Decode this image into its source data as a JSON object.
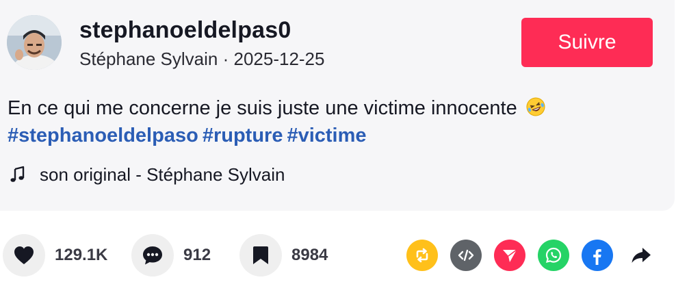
{
  "post": {
    "username": "stephanoeldelpas0",
    "display_name": "Stéphane Sylvain",
    "separator": " · ",
    "date": "2025-12-25",
    "follow_label": "Suivre",
    "description": "En ce qui me concerne je suis juste une victime innocente",
    "hashtags": [
      "#stephanoeldelpaso",
      "#rupture",
      "#victime"
    ],
    "music": "son original - Stéphane Sylvain"
  },
  "actions": {
    "likes": "129.1K",
    "comments": "912",
    "saves": "8984"
  },
  "share_buttons": [
    "repost-icon",
    "embed-icon",
    "send-icon",
    "whatsapp-icon",
    "facebook-icon",
    "share-arrow-icon"
  ],
  "colors": {
    "accent": "#fe2c55",
    "hashtag": "#2b5db5",
    "repost": "#ffc01a",
    "embed": "#5f6368",
    "send": "#fe2c55",
    "whatsapp": "#25d366",
    "facebook": "#1877f2"
  }
}
